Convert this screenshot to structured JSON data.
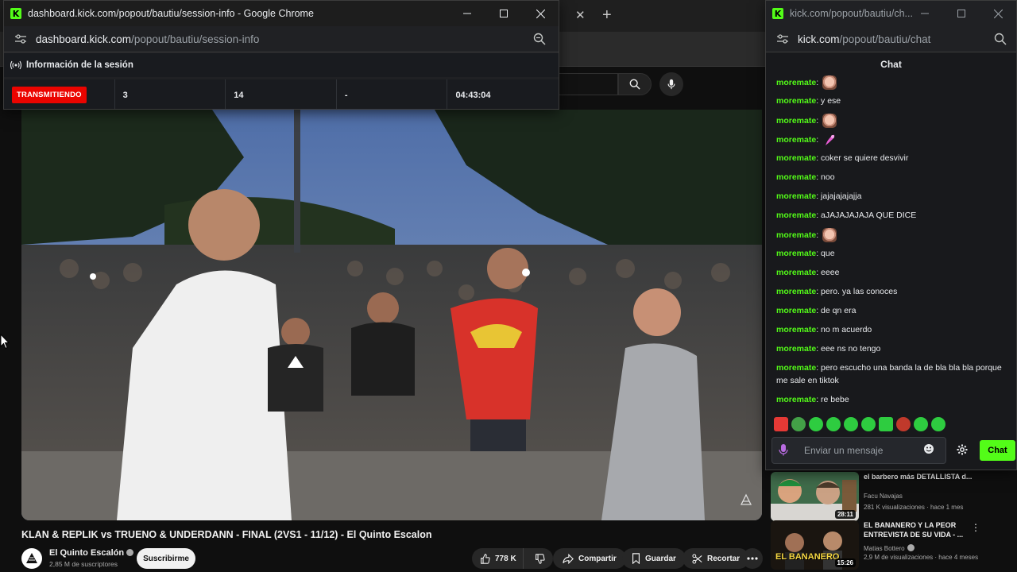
{
  "session_window": {
    "title": "dashboard.kick.com/popout/bautiu/session-info - Google Chrome",
    "url_host": "dashboard.kick.com",
    "url_path": "/popout/bautiu/session-info",
    "header": "Información de la sesión",
    "stats": {
      "status": "TRANSMITIENDO",
      "value_1": "3",
      "value_2": "14",
      "value_3": "-",
      "duration": "04:43:04"
    }
  },
  "chat_window": {
    "title": "kick.com/popout/bautiu/ch...",
    "url_host": "kick.com",
    "url_path": "/popout/bautiu/chat",
    "header": "Chat",
    "messages": [
      {
        "user": "moremate",
        "text": "",
        "emote": "face"
      },
      {
        "user": "moremate",
        "text": "y ese"
      },
      {
        "user": "moremate",
        "text": "",
        "emote": "face"
      },
      {
        "user": "moremate",
        "text": "",
        "emote": "pink"
      },
      {
        "user": "moremate",
        "text": "coker se quiere desvivir"
      },
      {
        "user": "moremate",
        "text": "noo"
      },
      {
        "user": "moremate",
        "text": "jajajajajajja"
      },
      {
        "user": "moremate",
        "text": "aJAJAJAJAJA QUE DICE"
      },
      {
        "user": "moremate",
        "text": "",
        "emote": "face"
      },
      {
        "user": "moremate",
        "text": "que"
      },
      {
        "user": "moremate",
        "text": "eeee"
      },
      {
        "user": "moremate",
        "text": "pero. ya las conoces"
      },
      {
        "user": "moremate",
        "text": "de qn era"
      },
      {
        "user": "moremate",
        "text": "no m acuerdo"
      },
      {
        "user": "moremate",
        "text": "eee ns no tengo"
      },
      {
        "user": "moremate",
        "text": "pero escucho una banda la de bla bla bla porque me sale en tiktok"
      },
      {
        "user": "moremate",
        "text": "re bebe"
      }
    ],
    "input_placeholder": "Enviar un mensaje",
    "send_label": "Chat",
    "emote_colors": [
      "#e53935",
      "#43a047",
      "#2ecc40",
      "#2ecc40",
      "#2ecc40",
      "#2ecc40",
      "#2ecc40",
      "#c0392b",
      "#2ecc40",
      "#2ecc40"
    ]
  },
  "youtube": {
    "video_title": "KLAN & REPLIK vs TRUENO & UNDERDANN - FINAL (2VS1 - 11/12) - El Quinto Escalon",
    "channel_name": "El Quinto Escalón",
    "subscribers": "2,85 M de suscriptores",
    "subscribe_label": "Suscribirme",
    "likes": "778 K",
    "share_label": "Compartir",
    "save_label": "Guardar",
    "clip_label": "Recortar",
    "recommendations": [
      {
        "title": "el barbero más DETALLISTA d...",
        "channel": "Facu Navajas",
        "meta": "281 K visualizaciones · hace 1 mes",
        "duration": "28:11"
      },
      {
        "title": "EL BANANERO Y LA PEOR ENTREVISTA DE SU VIDA - ...",
        "channel": "Matias Bottero",
        "meta": "2,9 M de visualizaciones · hace 4 meses",
        "duration": "15:26",
        "thumb_caption": "EL BANANERO"
      }
    ]
  },
  "colors": {
    "kick_green": "#53fc18",
    "live_red": "#eb0400",
    "background": "#0f0f0f"
  }
}
